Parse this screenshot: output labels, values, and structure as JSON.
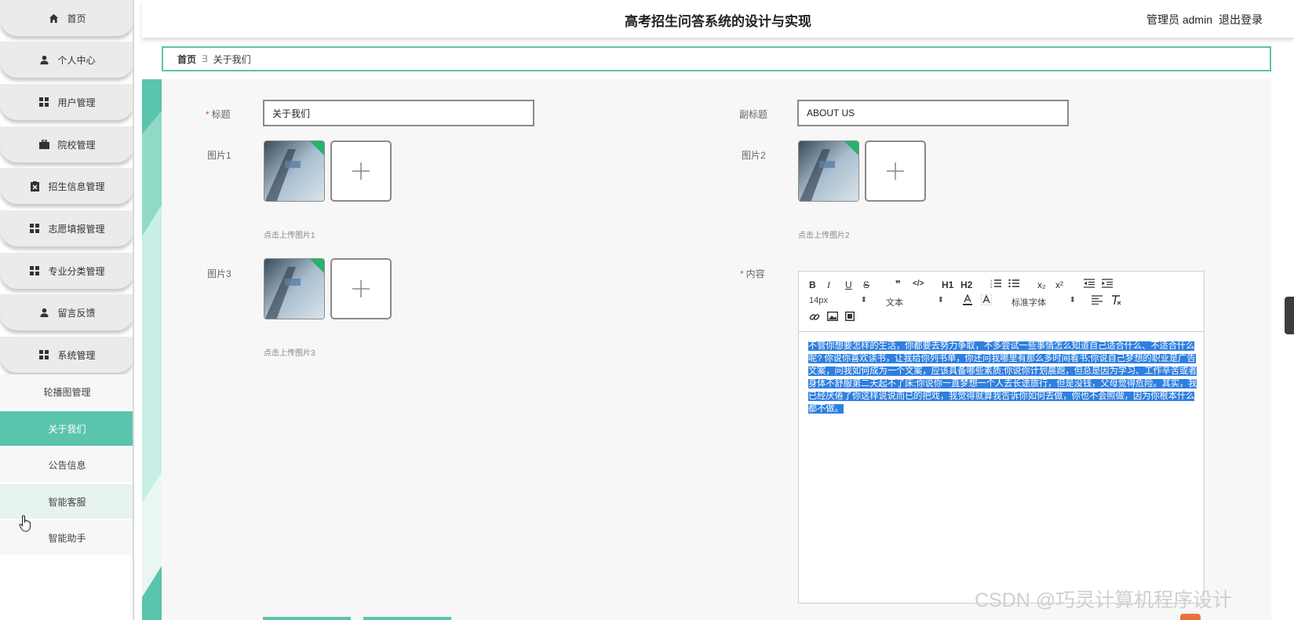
{
  "header": {
    "title": "高考招生问答系统的设计与实现",
    "user_label": "管理员 admin",
    "logout_label": "退出登录"
  },
  "sidebar": {
    "items": [
      {
        "label": "首页",
        "icon": "home-icon"
      },
      {
        "label": "个人中心",
        "icon": "user-icon"
      },
      {
        "label": "用户管理",
        "icon": "grid-icon"
      },
      {
        "label": "院校管理",
        "icon": "briefcase-icon"
      },
      {
        "label": "招生信息管理",
        "icon": "clipboard-icon"
      },
      {
        "label": "志愿填报管理",
        "icon": "grid-icon"
      },
      {
        "label": "专业分类管理",
        "icon": "grid-icon"
      },
      {
        "label": "留言反馈",
        "icon": "user-icon"
      },
      {
        "label": "系统管理",
        "icon": "grid-icon"
      }
    ],
    "sub_items": [
      {
        "label": "轮播图管理",
        "state": "normal"
      },
      {
        "label": "关于我们",
        "state": "active"
      },
      {
        "label": "公告信息",
        "state": "normal"
      },
      {
        "label": "智能客服",
        "state": "hover"
      },
      {
        "label": "智能助手",
        "state": "normal"
      }
    ]
  },
  "breadcrumb": {
    "home": "首页",
    "separator": "∃",
    "current": "关于我们"
  },
  "form": {
    "title_label": "标题",
    "title_value": "关于我们",
    "subtitle_label": "副标题",
    "subtitle_value": "ABOUT US",
    "image1_label": "图片1",
    "image1_hint": "点击上传图片1",
    "image2_label": "图片2",
    "image2_hint": "点击上传图片2",
    "image3_label": "图片3",
    "image3_hint": "点击上传图片3",
    "content_label": "内容",
    "required_mark": "*"
  },
  "editor": {
    "font_size": "14px",
    "block_type": "文本",
    "font_family": "标准字体",
    "content": "不管你想要怎样的生活，你都要去努力争取，不多尝试一些事情怎么知道自己适合什么、不适合什么呢? 你说你喜欢读书，让我给你列书单，你还问我哪里有那么多时间看书;你说自己梦想的职业是广告文案，问我如何成为一个文案，应该具备哪些素质;你说你计划晨跑，但总是因为学习、工作辛苦或者身体不舒服第二天起不了床;你说你一直梦想一个人去长途旅行，但是没钱，父母觉得危险。其实，我已经厌倦了你这样说说而已的把戏，我觉得就算我告诉你如何去做，你也不会照做，因为你根本什么都不做。",
    "buttons": {
      "bold": "B",
      "italic": "I",
      "underline": "U",
      "strike": "S",
      "quote": "❞",
      "code": "</>",
      "h1": "H1",
      "h2": "H2",
      "subscript": "x₂",
      "superscript": "x²"
    }
  },
  "watermark": "CSDN @巧灵计算机程序设计",
  "colors": {
    "accent": "#5bc4ad",
    "selection": "#2f7fe0",
    "required": "#e0502f"
  }
}
